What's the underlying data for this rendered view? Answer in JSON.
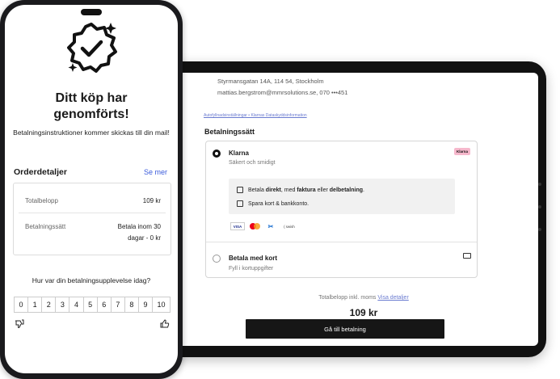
{
  "tablet": {
    "address_line1": "Styrmansgatan 14A, 114 54, Stockholm",
    "address_line2": "mattias.bergstrom@mmrsolutions.se, 070 •••451",
    "links": "Autofyllnadsinställningar • Klarnas Dataskyddsinformation",
    "payment_title": "Betalningssätt",
    "klarna": {
      "title": "Klarna",
      "subtitle": "Säkert och smidigt",
      "badge": "Klarna",
      "info_row1_pre": "Betala ",
      "info_row1_b1": "direkt",
      "info_row1_mid": ", med ",
      "info_row1_b2": "faktura",
      "info_row1_mid2": " eller ",
      "info_row1_b3": "delbetalning",
      "info_row1_end": ".",
      "info_row2": "Spara kort & bankkonto.",
      "logos": [
        "VISA",
        "mastercard",
        "AMEX",
        "swish"
      ],
      "swish_label": "swish"
    },
    "card": {
      "title": "Betala med kort",
      "subtitle": "Fyll i kortuppgifter"
    },
    "total_label": "Totalbelopp inkl. moms",
    "total_link": "Visa detaljer",
    "total_amount": "109 kr",
    "go_button": "Gå till betalning"
  },
  "phone": {
    "title": "Ditt köp har genomförts!",
    "description": "Betalningsinstruktioner kommer skickas till din mail!",
    "order_heading": "Orderdetaljer",
    "see_more": "Se mer",
    "total_label": "Totalbelopp",
    "total_value": "109 kr",
    "method_label": "Betalningssätt",
    "method_value_1": "Betala inom 30",
    "method_value_2": "dagar - 0 kr",
    "question": "Hur var din betalningsupplevelse idag?",
    "scale": [
      "0",
      "1",
      "2",
      "3",
      "4",
      "5",
      "6",
      "7",
      "8",
      "9",
      "10"
    ]
  }
}
